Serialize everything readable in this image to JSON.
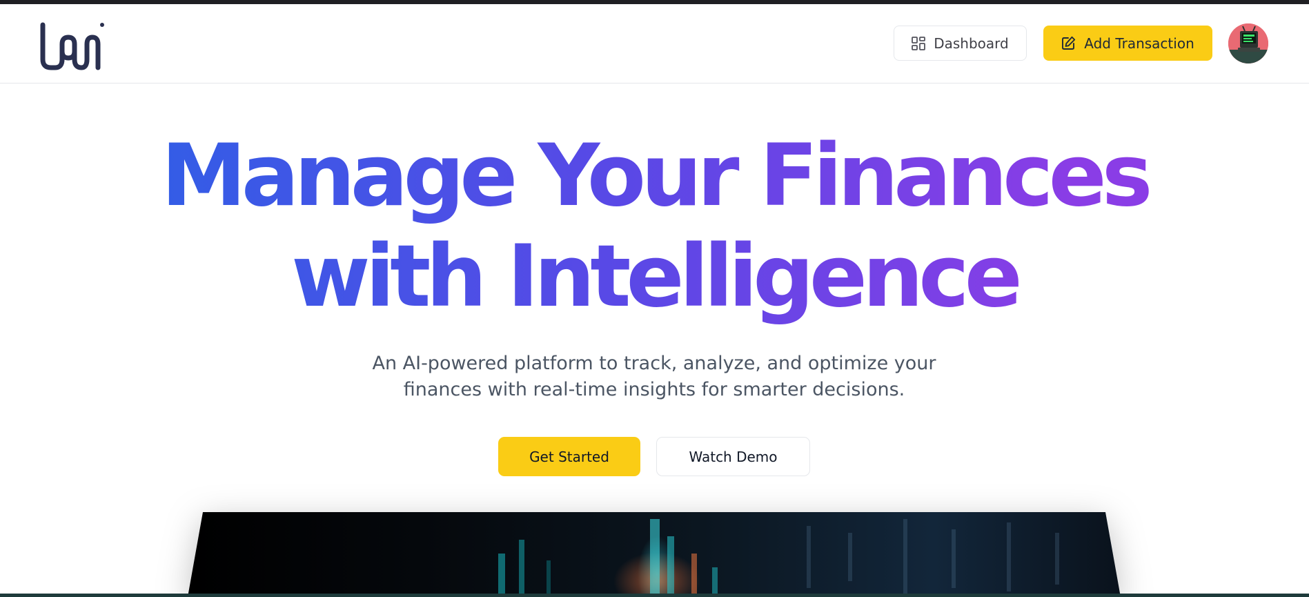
{
  "header": {
    "logo_text": "loan",
    "dashboard_label": "Dashboard",
    "dashboard_icon": "layout-grid-icon",
    "add_transaction_label": "Add Transaction",
    "add_transaction_icon": "pencil-square-icon",
    "avatar_icon": "retro-computer-avatar"
  },
  "hero": {
    "title_line1": "Manage Your Finances",
    "title_line2": "with Intelligence",
    "subtitle_line1": "An AI-powered platform to track, analyze, and optimize your",
    "subtitle_line2": "finances with real-time insights for smarter decisions.",
    "get_started_label": "Get Started",
    "watch_demo_label": "Watch Demo",
    "gradient_colors": [
      "#2f5fe6",
      "#5a48e6",
      "#8a3de6"
    ]
  },
  "colors": {
    "accent_yellow": "#facc15",
    "border": "#e5e7eb",
    "text_gray": "#4b5563",
    "logo_navy": "#2a3050"
  }
}
